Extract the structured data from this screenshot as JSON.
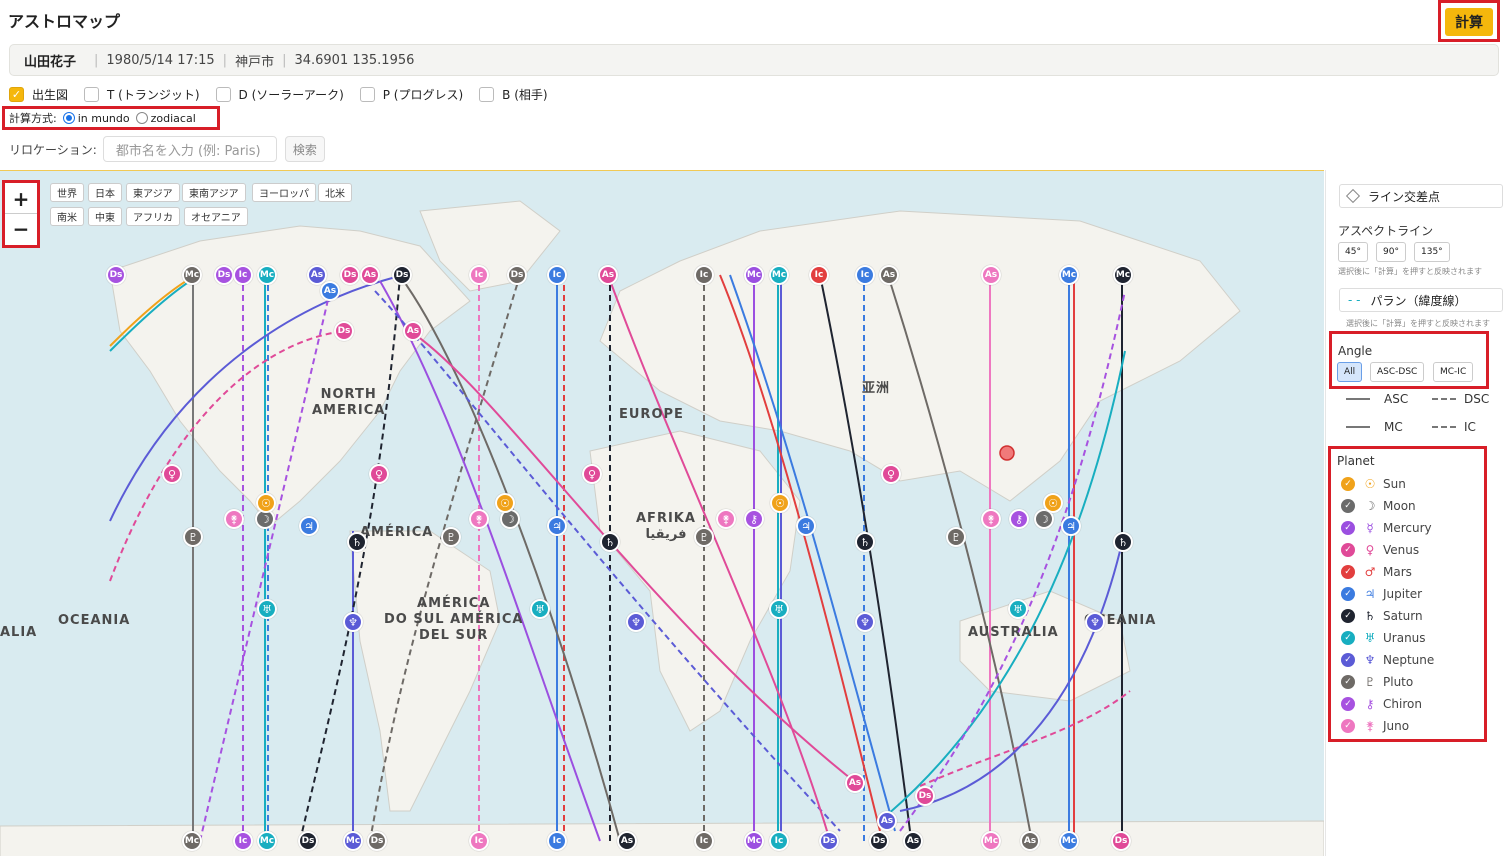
{
  "app_title": "アストロマップ",
  "calc_label": "計算",
  "info": {
    "name": "山田花子",
    "datetime": "1980/5/14 17:15",
    "city": "神戸市",
    "coords": "34.6901 135.1956"
  },
  "chart_types": [
    {
      "label": "出生図",
      "checked": true
    },
    {
      "label": "T (トランジット)",
      "checked": false
    },
    {
      "label": "D (ソーラーアーク)",
      "checked": false
    },
    {
      "label": "P (プログレス)",
      "checked": false
    },
    {
      "label": "B (相手)",
      "checked": false
    }
  ],
  "method": {
    "label": "計算方式:",
    "option1": "in mundo",
    "option2": "zodiacal",
    "selected": "in mundo"
  },
  "relocation": {
    "label": "リロケーション:",
    "placeholder": "都市名を入力 (例: Paris)",
    "search_label": "検索"
  },
  "zoom": {
    "in": "+",
    "out": "−"
  },
  "regions_row1": [
    "世界",
    "日本",
    "東アジア",
    "東南アジア",
    "ヨーロッパ",
    "北米"
  ],
  "regions_row2": [
    "南米",
    "中東",
    "アフリカ",
    "オセアニア"
  ],
  "map_labels": {
    "north_america": "NORTH\nAMERICA",
    "europe": "EUROPE",
    "asia": "亚洲",
    "america": "AMÉRICA",
    "africa": "AFRIKA\nفريقيا",
    "south_america": "AMÉRICA\nDO SUL AMÉRICA\nDEL SUR",
    "oceania_left": "OCEANIA",
    "alia": "ALIA",
    "australia": "AUSTRALIA",
    "oceania_right": "OCEANIA"
  },
  "sidebar": {
    "crossing": "ライン交差点",
    "aspect_title": "アスペクトライン",
    "aspects": [
      "45°",
      "90°",
      "135°"
    ],
    "aspect_note": "選択後に「計算」を押すと反映されます",
    "paran": "パラン（緯度線）",
    "paran_note": "選択後に「計算」を押すと反映されます",
    "angle_title": "Angle",
    "angles": [
      "All",
      "ASC-DSC",
      "MC-IC"
    ],
    "angle_selected": "All",
    "legend": {
      "asc": "ASC",
      "dsc": "DSC",
      "mc": "MC",
      "ic": "IC"
    },
    "planet_title": "Planet",
    "planets": [
      {
        "name": "Sun",
        "symbol": "☉",
        "color": "#f0a21a"
      },
      {
        "name": "Moon",
        "symbol": "☽",
        "color": "#6b6b6b"
      },
      {
        "name": "Mercury",
        "symbol": "☿",
        "color": "#9b4fe0"
      },
      {
        "name": "Venus",
        "symbol": "♀",
        "color": "#e04a98"
      },
      {
        "name": "Mars",
        "symbol": "♂",
        "color": "#e23e3e"
      },
      {
        "name": "Jupiter",
        "symbol": "♃",
        "color": "#3b7be0"
      },
      {
        "name": "Saturn",
        "symbol": "♄",
        "color": "#1f2430"
      },
      {
        "name": "Uranus",
        "symbol": "♅",
        "color": "#18aec0"
      },
      {
        "name": "Neptune",
        "symbol": "♆",
        "color": "#5b5bd6"
      },
      {
        "name": "Pluto",
        "symbol": "♇",
        "color": "#6e6a66"
      },
      {
        "name": "Chiron",
        "symbol": "⚷",
        "color": "#a752e0"
      },
      {
        "name": "Juno",
        "symbol": "⚵",
        "color": "#ee77c0"
      }
    ]
  },
  "markers": [
    "Ds",
    "Mc",
    "Ds",
    "Ic",
    "Mc",
    "As",
    "Ds",
    "As",
    "Ds",
    "Ic",
    "Ds",
    "Ic",
    "As",
    "Ic",
    "Mc",
    "Ic",
    "As",
    "Ic",
    "As",
    "Mc",
    "Mc",
    "Mc",
    "As",
    "As",
    "Ds",
    "As",
    "Mc",
    "Ic",
    "Mc",
    "Ds",
    "Mc",
    "Ds",
    "Ic",
    "Ic",
    "As",
    "Ic",
    "Mc",
    "Ic",
    "Ds",
    "Ds",
    "As",
    "Ds",
    "As",
    "Mc",
    "Mc",
    "As",
    "Ds"
  ]
}
